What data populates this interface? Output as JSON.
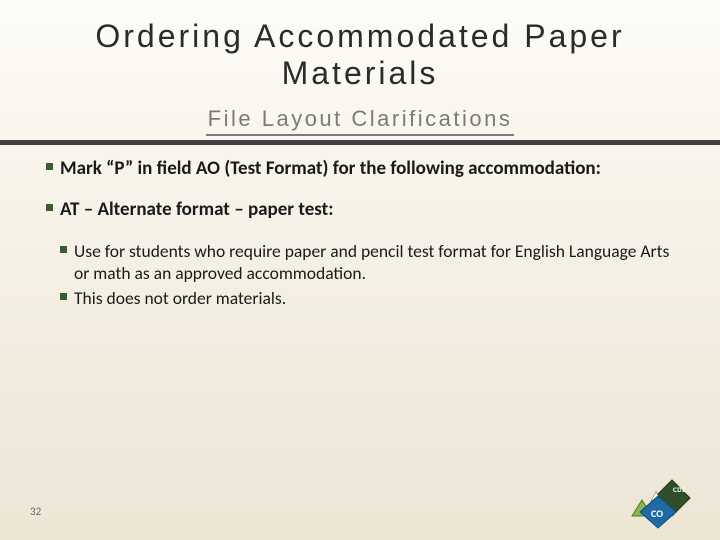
{
  "header": {
    "title": "Ordering Accommodated Paper Materials",
    "subtitle": "File Layout Clarifications"
  },
  "bullets": {
    "b1": "Mark “P” in field AO (Test Format) for the following accommodation:",
    "b2": "AT – Alternate format – paper test:",
    "b2_children": {
      "c1": "Use for students who require paper and pencil test format for English Language Arts or math as an approved accommodation.",
      "c2": "This does not order materials."
    }
  },
  "footer": {
    "page_number": "32",
    "logo_top": "CDE",
    "logo_bottom": "CO"
  }
}
